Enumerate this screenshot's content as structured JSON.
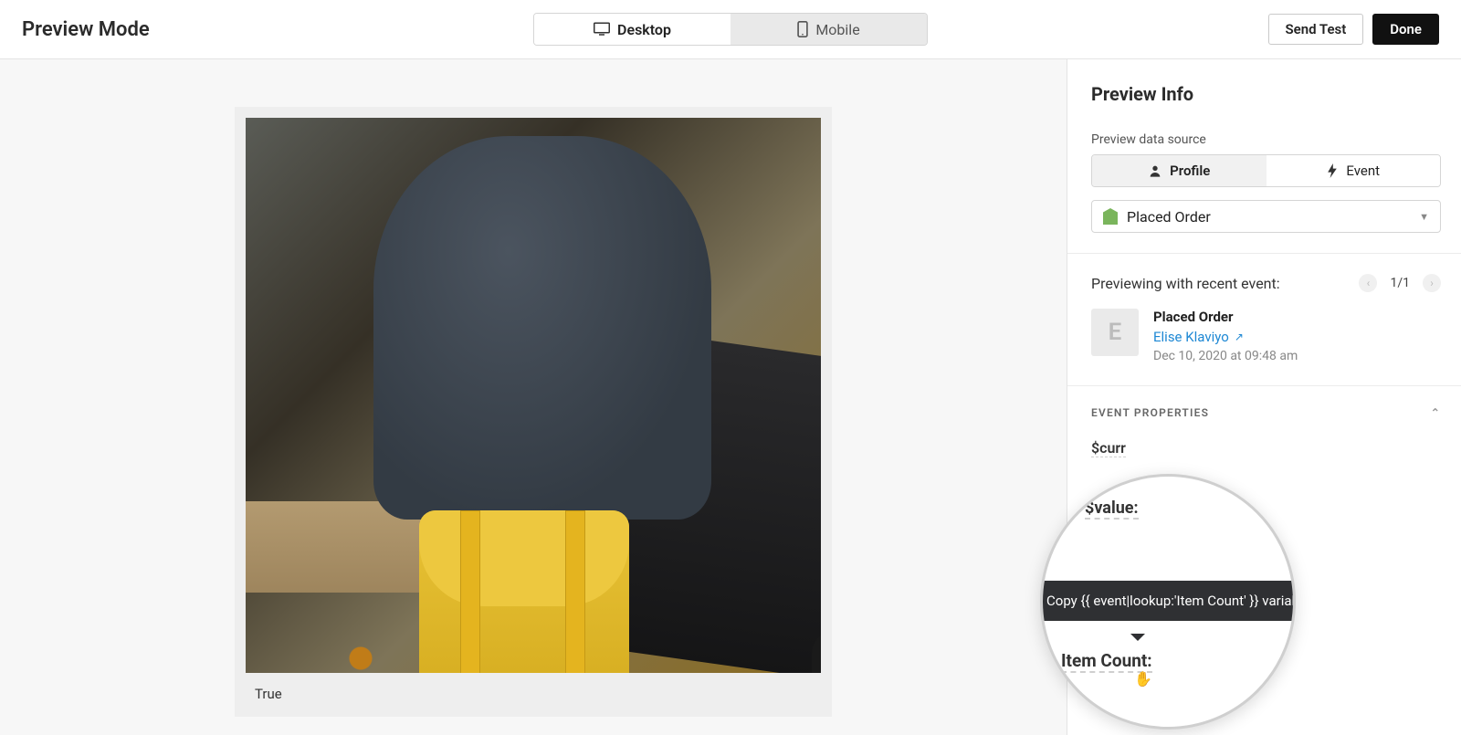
{
  "topbar": {
    "title": "Preview Mode",
    "desktop_label": "Desktop",
    "mobile_label": "Mobile",
    "send_test_label": "Send Test",
    "done_label": "Done"
  },
  "preview": {
    "caption": "True"
  },
  "sidebar": {
    "heading": "Preview Info",
    "datasource_label": "Preview data source",
    "profile_label": "Profile",
    "event_label": "Event",
    "dropdown_value": "Placed Order",
    "previewing_label": "Previewing with recent event:",
    "pager_count": "1/1",
    "event": {
      "avatar_initial": "E",
      "title": "Placed Order",
      "person": "Elise Klaviyo",
      "timestamp": "Dec 10, 2020 at 09:48 am"
    },
    "event_properties_header": "EVENT PROPERTIES",
    "props": {
      "currency_partial": "$curr",
      "value_label": "$value:",
      "item_count_label": "Item Count:",
      "items_partial": "Ite"
    },
    "tooltip_text": "Copy {{ event|lookup:'Item Count' }} variable"
  }
}
